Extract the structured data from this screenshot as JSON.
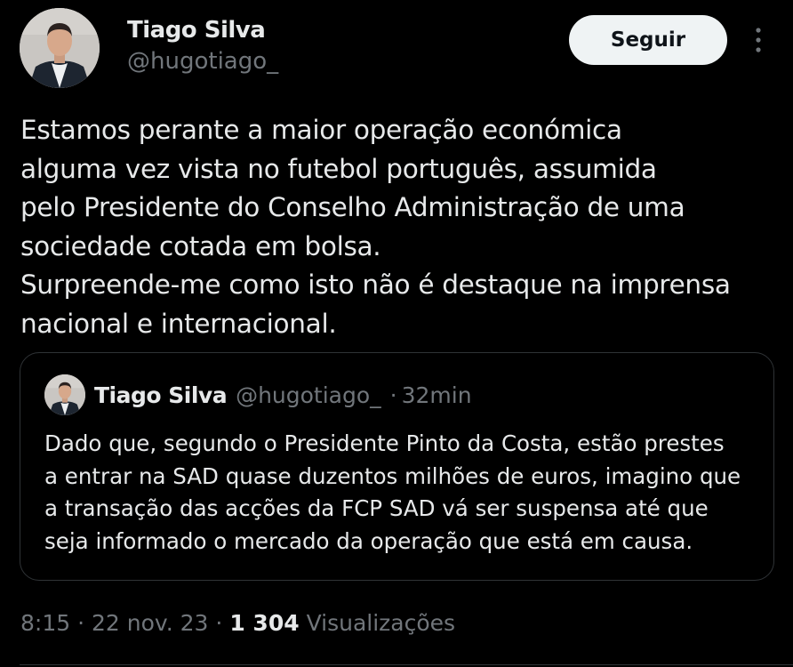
{
  "tweet": {
    "author": {
      "name": "Tiago Silva",
      "handle": "@hugotiago_"
    },
    "follow_label": "Seguir",
    "more_icon": "more-vertical-icon",
    "text": "Estamos perante a maior operação económica\nalguma vez vista no futebol português, assumida\npelo Presidente do Conselho Administração de uma\nsociedade cotada em bolsa.\nSurpreende-me como isto não é destaque na imprensa\nnacional e internacional.",
    "quoted": {
      "name": "Tiago Silva",
      "handle": "@hugotiago_",
      "separator": "·",
      "time": "32min",
      "text": "Dado que, segundo o Presidente Pinto da Costa, estão prestes\na entrar na SAD quase duzentos milhões de euros, imagino que\na transação das acções da FCP SAD vá ser suspensa até que\nseja informado o mercado da operação que está em causa."
    },
    "meta": {
      "time": "8:15",
      "sep1": "·",
      "date": "22 nov. 23",
      "sep2": "·",
      "views_count": "1 304",
      "views_label": "Visualizações"
    }
  },
  "colors": {
    "background": "#000000",
    "primary_text": "#e7e9ea",
    "secondary_text": "#71767b",
    "border": "#2f3336",
    "button_bg": "#eff3f4",
    "button_text": "#0f1419"
  }
}
